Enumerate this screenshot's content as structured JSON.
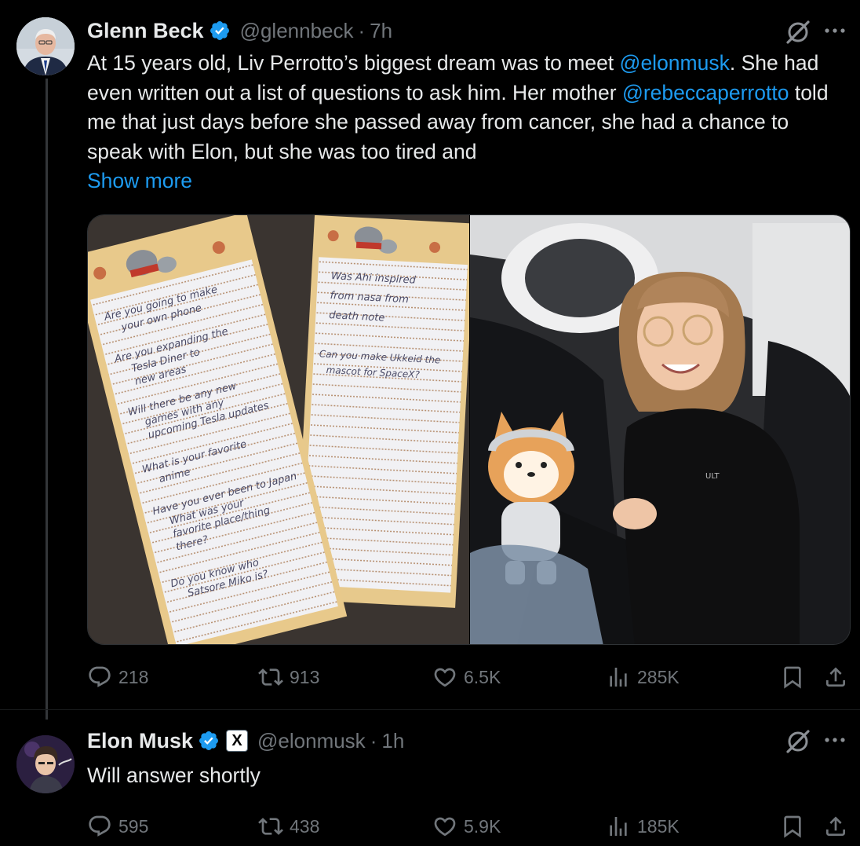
{
  "tweets": [
    {
      "author": {
        "name": "Glenn Beck",
        "handle": "@glennbeck",
        "time": "7h"
      },
      "text": {
        "p1": "At 15 years old, Liv Perrotto’s biggest dream was to meet ",
        "m1": "@elonmusk",
        "p2": ". She had even written out a list of questions to ask him. Her mother ",
        "m2": "@rebeccaperrotto",
        "p3": " told me that just days before she passed away from cancer, she had a chance to speak with Elon, but she was too tired and",
        "show_more": "Show more"
      },
      "stats": {
        "replies": "218",
        "reposts": "913",
        "likes": "6.5K",
        "views": "285K"
      }
    },
    {
      "author": {
        "name": "Elon Musk",
        "affiliation": "X",
        "handle": "@elonmusk",
        "time": "1h"
      },
      "text": "Will answer shortly",
      "stats": {
        "replies": "595",
        "reposts": "438",
        "likes": "5.9K",
        "views": "185K"
      }
    }
  ],
  "icons": {
    "verified": "verified-badge-icon",
    "grok": "grok-icon",
    "more": "more-icon",
    "reply": "reply-icon",
    "repost": "repost-icon",
    "like": "heart-icon",
    "views": "views-icon",
    "bookmark": "bookmark-icon",
    "share": "share-icon"
  },
  "colors": {
    "background": "#000000",
    "text": "#e7e9ea",
    "muted": "#71767b",
    "accent": "#1d9bf0"
  }
}
